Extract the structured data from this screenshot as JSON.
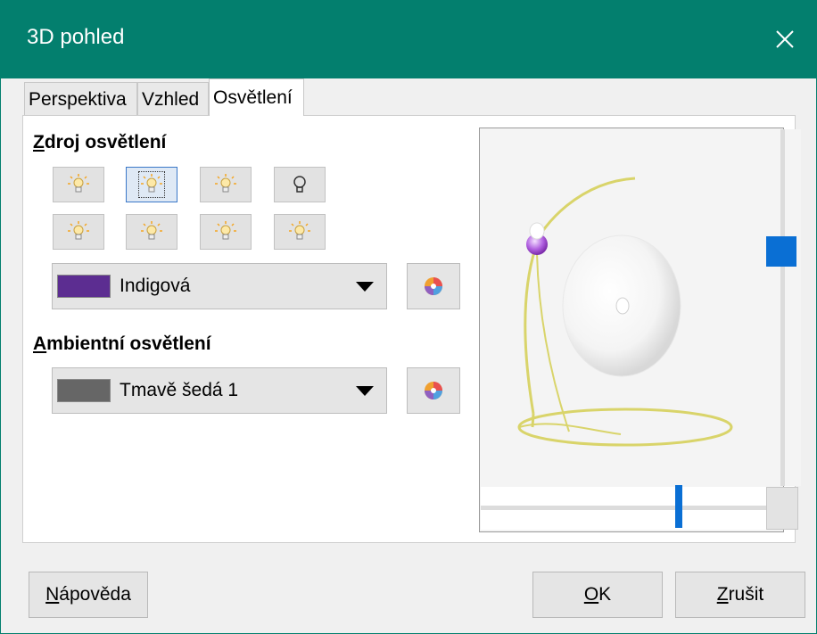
{
  "window": {
    "title": "3D pohled",
    "close_icon": "close-icon"
  },
  "tabs": [
    {
      "label": "Perspektiva",
      "active": false
    },
    {
      "label": "Vzhled",
      "active": false
    },
    {
      "label": "Osvětlení",
      "active": true
    }
  ],
  "light_source": {
    "heading_first": "Z",
    "heading_rest": "droj osvětlení",
    "buttons": [
      {
        "icon": "light-bulb-on-icon",
        "selected": false
      },
      {
        "icon": "light-bulb-on-icon",
        "selected": true
      },
      {
        "icon": "light-bulb-on-icon",
        "selected": false
      },
      {
        "icon": "light-bulb-off-icon",
        "selected": false
      },
      {
        "icon": "light-bulb-on-icon",
        "selected": false
      },
      {
        "icon": "light-bulb-on-icon",
        "selected": false
      },
      {
        "icon": "light-bulb-on-icon",
        "selected": false
      },
      {
        "icon": "light-bulb-on-icon",
        "selected": false
      }
    ],
    "color_value": "Indigová",
    "color_hex": "#5c2d91"
  },
  "ambient": {
    "heading_first": "A",
    "heading_rest": "mbientní osvětlení",
    "color_value": "Tmavě šedá 1",
    "color_hex": "#666666"
  },
  "colors": {
    "titlebar": "#037f6e",
    "accent": "#0a6fd4"
  },
  "buttons": {
    "help_first": "N",
    "help_rest": "ápověda",
    "ok_first": "O",
    "ok_rest": "K",
    "cancel_first": "Z",
    "cancel_rest": "rušit"
  }
}
